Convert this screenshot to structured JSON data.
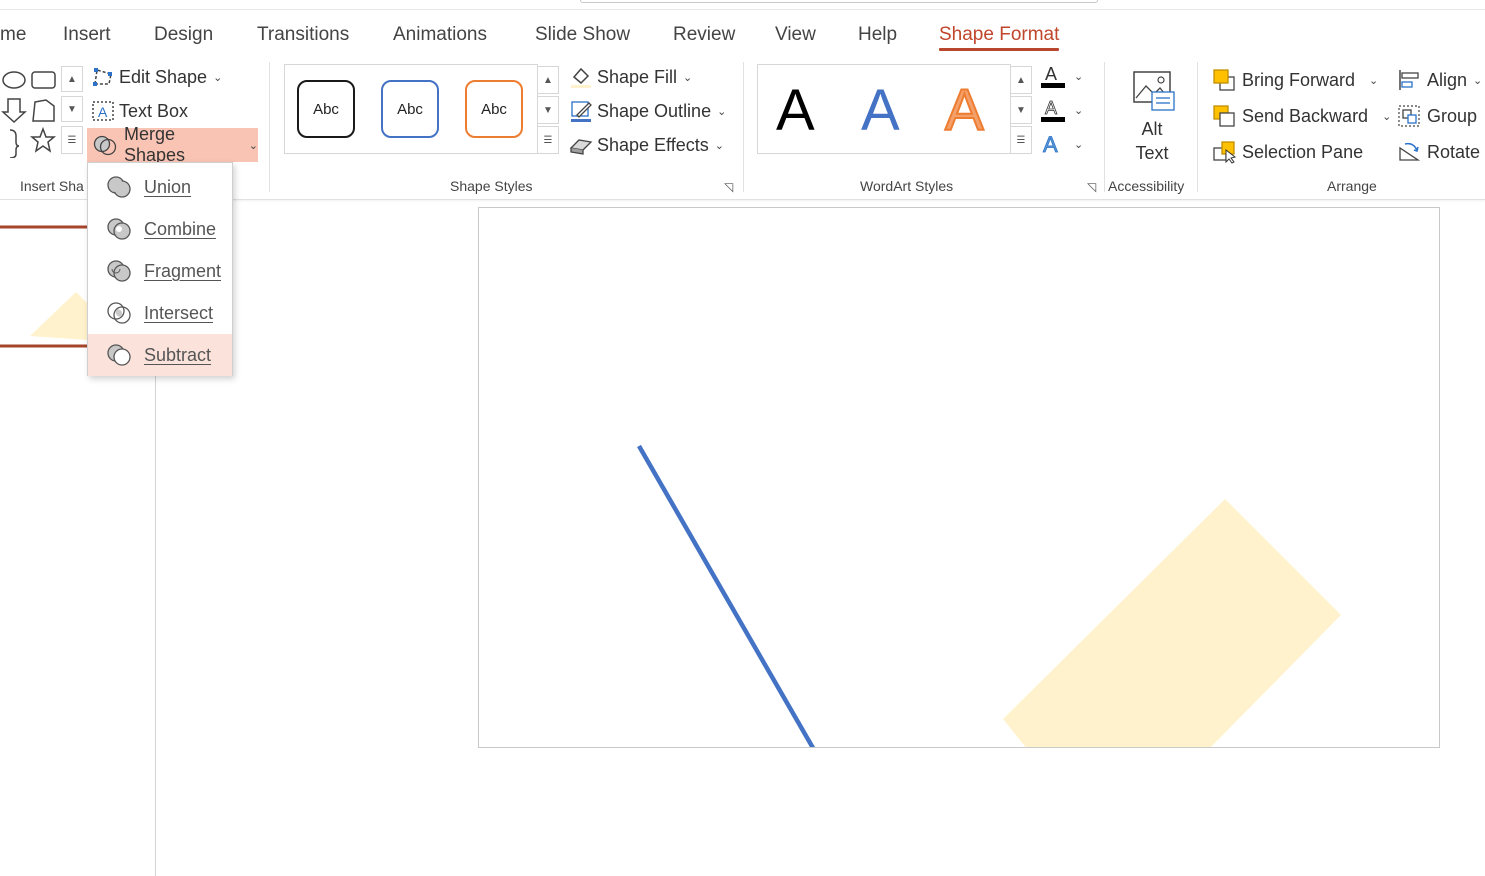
{
  "tabs": [
    {
      "label": "me",
      "active": false
    },
    {
      "label": "Insert",
      "active": false
    },
    {
      "label": "Design",
      "active": false
    },
    {
      "label": "Transitions",
      "active": false
    },
    {
      "label": "Animations",
      "active": false
    },
    {
      "label": "Slide Show",
      "active": false
    },
    {
      "label": "Review",
      "active": false
    },
    {
      "label": "View",
      "active": false
    },
    {
      "label": "Help",
      "active": false
    },
    {
      "label": "Shape Format",
      "active": true
    }
  ],
  "insert_shapes": {
    "edit_shape": "Edit Shape",
    "text_box": "Text Box",
    "merge_shapes": "Merge Shapes",
    "group_label": "Insert Sha"
  },
  "merge_menu": {
    "items": [
      {
        "label": "Union",
        "highlighted": false
      },
      {
        "label": "Combine",
        "highlighted": false
      },
      {
        "label": "Fragment",
        "highlighted": false
      },
      {
        "label": "Intersect",
        "highlighted": false
      },
      {
        "label": "Subtract",
        "highlighted": true
      }
    ]
  },
  "shape_styles": {
    "presets": [
      {
        "label": "Abc",
        "border": "#1a1a1a"
      },
      {
        "label": "Abc",
        "border": "#4472c4"
      },
      {
        "label": "Abc",
        "border": "#ed7d31"
      }
    ],
    "shape_fill": "Shape Fill",
    "shape_outline": "Shape Outline",
    "shape_effects": "Shape Effects",
    "group_label": "Shape Styles"
  },
  "wordart": {
    "samples": [
      {
        "label": "A",
        "color": "#000000"
      },
      {
        "label": "A",
        "color": "#4472c4"
      },
      {
        "label": "A",
        "color": "#ed7d31"
      }
    ],
    "group_label": "WordArt Styles"
  },
  "accessibility": {
    "alt_text_line1": "Alt",
    "alt_text_line2": "Text",
    "group_label": "Accessibility"
  },
  "arrange": {
    "bring_forward": "Bring Forward",
    "send_backward": "Send Backward",
    "selection_pane": "Selection Pane",
    "align": "Align",
    "group": "Group",
    "rotate": "Rotate",
    "group_label": "Arrange"
  },
  "colors": {
    "accent": "#c0462c",
    "merge_highlight": "#f9c4b4",
    "menu_highlight": "#fbe3dc",
    "line_blue": "#4472c4",
    "shape_yellow": "#fff2cc",
    "thumb_line": "#a5452a"
  }
}
